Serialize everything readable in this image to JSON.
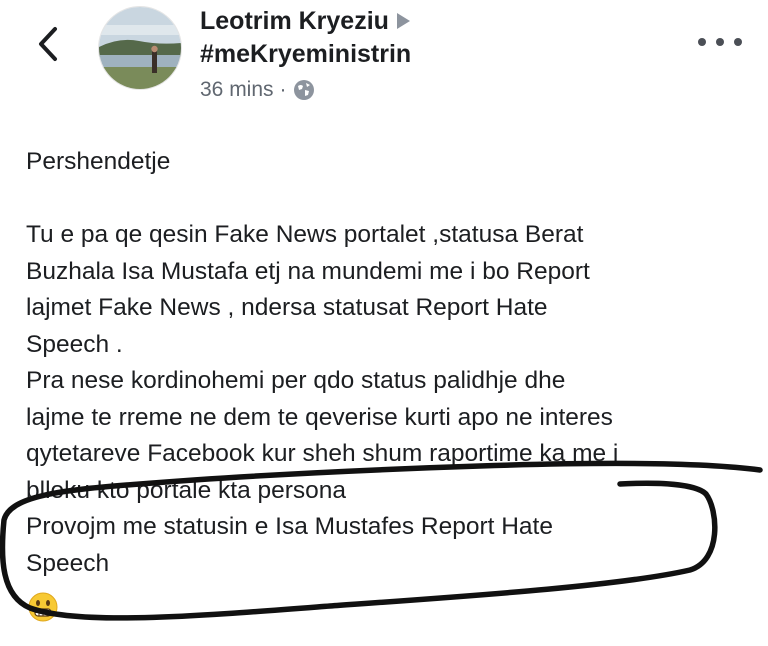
{
  "header": {
    "author_name": "Leotrim Kryeziu",
    "group_name": "#meKryeministrin",
    "timestamp": "36 mins",
    "separator": "·",
    "privacy_icon": "globe-icon",
    "back_icon": "chevron-left-icon",
    "more_icon": "more-options-icon",
    "author_arrow_icon": "triangle-right-icon"
  },
  "post": {
    "lines": [
      "Pershendetje",
      "",
      "Tu e pa qe qesin Fake News portalet ,statusa Berat",
      "Buzhala Isa Mustafa etj na mundemi me i bo Report",
      "lajmet Fake News , ndersa statusat Report  Hate",
      "Speech .",
      "Pra nese kordinohemi per qdo status palidhje dhe",
      "lajme te rreme ne dem te qeverise kurti apo ne interes",
      "qytetareve Facebook kur sheh shum raportime ka me i",
      "blloku kto portale kta persona",
      "Provojm me statusin e Isa Mustafes Report Hate",
      "Speech"
    ],
    "emoji": "grimacing-face-emoji"
  },
  "colors": {
    "text": "#1c1e21",
    "meta": "#606770",
    "icon_gray": "#8d949e",
    "annotation": "#111111",
    "emoji_yellow": "#f7c934"
  }
}
